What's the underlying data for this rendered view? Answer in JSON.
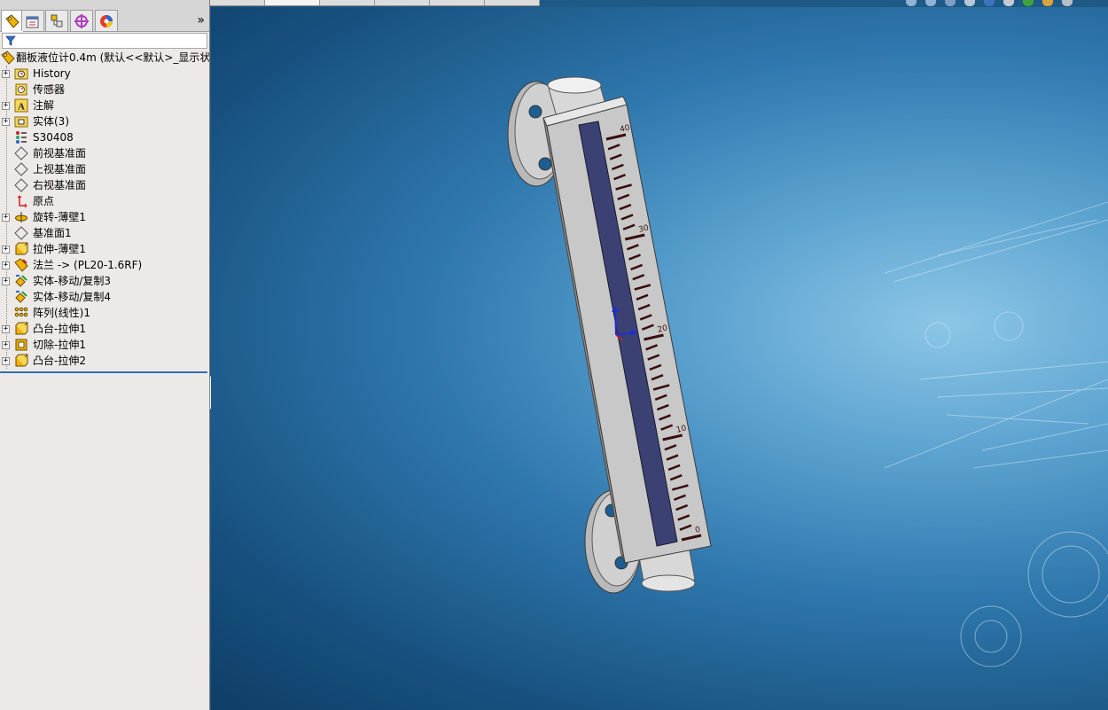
{
  "feature_tree": {
    "root_label": "翻板液位计0.4m  (默认<<默认>_显示状",
    "items": [
      {
        "label": "History",
        "icon": "history-folder-icon",
        "expandable": true
      },
      {
        "label": "传感器",
        "icon": "sensor-icon",
        "expandable": false
      },
      {
        "label": "注解",
        "icon": "annotation-icon",
        "expandable": true
      },
      {
        "label": "实体(3)",
        "icon": "solid-bodies-folder-icon",
        "expandable": true
      },
      {
        "label": "S30408",
        "icon": "material-icon",
        "expandable": false
      },
      {
        "label": "前视基准面",
        "icon": "plane-icon",
        "expandable": false
      },
      {
        "label": "上视基准面",
        "icon": "plane-icon",
        "expandable": false
      },
      {
        "label": "右视基准面",
        "icon": "plane-icon",
        "expandable": false
      },
      {
        "label": "原点",
        "icon": "origin-icon",
        "expandable": false
      },
      {
        "label": "旋转-薄壁1",
        "icon": "revolve-icon",
        "expandable": true
      },
      {
        "label": "基准面1",
        "icon": "plane-icon",
        "expandable": false
      },
      {
        "label": "拉伸-薄壁1",
        "icon": "extrude-icon",
        "expandable": true
      },
      {
        "label": "法兰 -> (PL20-1.6RF)",
        "icon": "library-feature-icon",
        "expandable": true
      },
      {
        "label": "实体-移动/复制3",
        "icon": "move-copy-icon",
        "expandable": true
      },
      {
        "label": "实体-移动/复制4",
        "icon": "move-copy-icon",
        "expandable": false
      },
      {
        "label": "阵列(线性)1",
        "icon": "linear-pattern-icon",
        "expandable": false
      },
      {
        "label": "凸台-拉伸1",
        "icon": "boss-extrude-icon",
        "expandable": true
      },
      {
        "label": "切除-拉伸1",
        "icon": "cut-extrude-icon",
        "expandable": true
      },
      {
        "label": "凸台-拉伸2",
        "icon": "boss-extrude-icon",
        "expandable": true
      }
    ]
  },
  "panel_tabs": [
    {
      "name": "feature-manager-tab",
      "icon": "feature-manager-icon",
      "active": true
    },
    {
      "name": "property-manager-tab",
      "icon": "property-manager-icon",
      "active": false
    },
    {
      "name": "configuration-manager-tab",
      "icon": "configuration-manager-icon",
      "active": false
    },
    {
      "name": "dimxpert-manager-tab",
      "icon": "dimxpert-icon",
      "active": false
    },
    {
      "name": "display-manager-tab",
      "icon": "display-manager-icon",
      "active": false
    }
  ],
  "expand_symbol": "»",
  "collapse_symbol": "+",
  "scale_labels": [
    "40",
    "30",
    "20",
    "10",
    "0"
  ],
  "colors": {
    "panel_bg": "#ece9e6",
    "selection_line": "#2f6fb7",
    "viewport_dark": "#0f3e66",
    "viewport_light": "#8cc6e6",
    "gauge_body": "#c8c8c8",
    "gauge_window": "#3c4173",
    "scale_mark": "#3a0e0e"
  }
}
